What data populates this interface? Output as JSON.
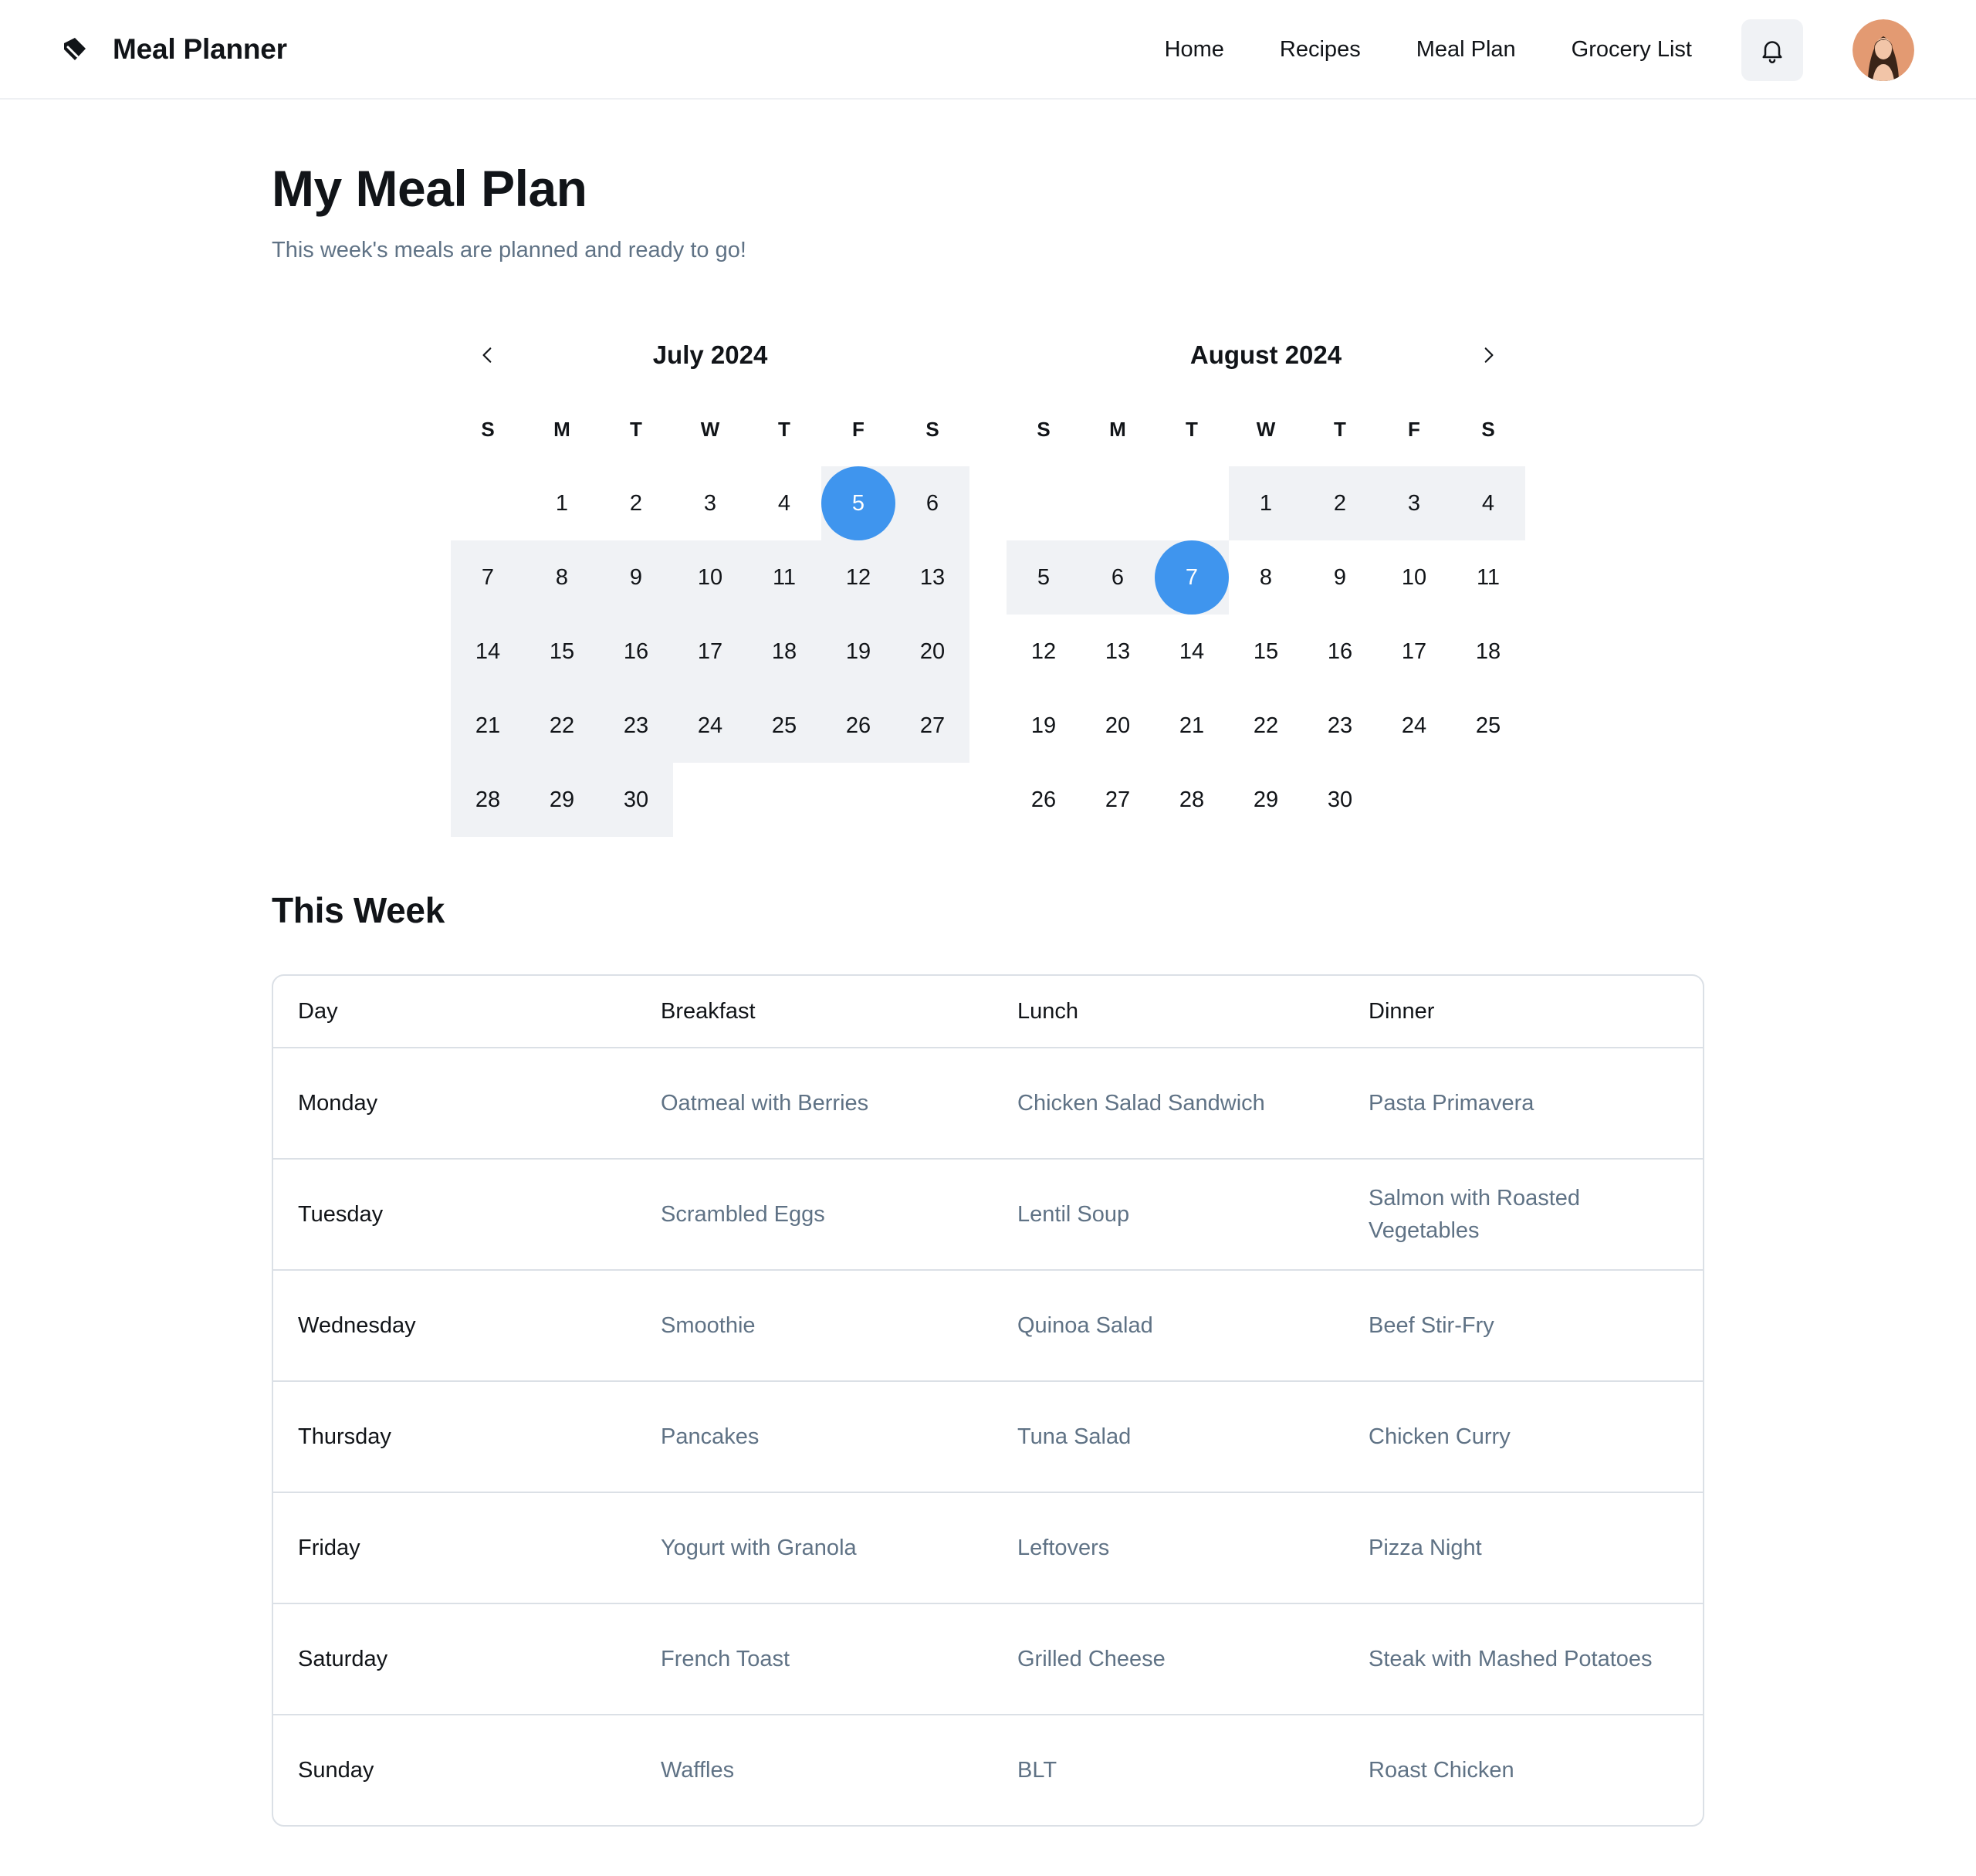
{
  "header": {
    "brand_title": "Meal Planner",
    "nav": [
      "Home",
      "Recipes",
      "Meal Plan",
      "Grocery List"
    ],
    "icons": {
      "logo": "tag-icon",
      "bell": "bell-icon",
      "avatar": "user-avatar"
    }
  },
  "page": {
    "title": "My Meal Plan",
    "subtitle": "This week's meals are planned and ready to go!"
  },
  "calendar": {
    "weekdays": [
      "S",
      "M",
      "T",
      "W",
      "T",
      "F",
      "S"
    ],
    "months": [
      {
        "title": "July 2024",
        "first_weekday": 1,
        "days": 30,
        "range_start": 5,
        "range_end": 30,
        "selected": 5
      },
      {
        "title": "August 2024",
        "first_weekday": 3,
        "days": 30,
        "range_start": 1,
        "range_end": 7,
        "selected": 7
      }
    ],
    "colors": {
      "selected": "#3f95ee",
      "range": "#f0f2f5"
    }
  },
  "week": {
    "title": "This Week",
    "columns": [
      "Day",
      "Breakfast",
      "Lunch",
      "Dinner"
    ],
    "rows": [
      [
        "Monday",
        "Oatmeal with Berries",
        "Chicken Salad Sandwich",
        "Pasta Primavera"
      ],
      [
        "Tuesday",
        "Scrambled Eggs",
        "Lentil Soup",
        "Salmon with Roasted Vegetables"
      ],
      [
        "Wednesday",
        "Smoothie",
        "Quinoa Salad",
        "Beef Stir-Fry"
      ],
      [
        "Thursday",
        "Pancakes",
        "Tuna Salad",
        "Chicken Curry"
      ],
      [
        "Friday",
        "Yogurt with Granola",
        "Leftovers",
        "Pizza Night"
      ],
      [
        "Saturday",
        "French Toast",
        "Grilled Cheese",
        "Steak with Mashed Potatoes"
      ],
      [
        "Sunday",
        "Waffles",
        "BLT",
        "Roast Chicken"
      ]
    ]
  }
}
